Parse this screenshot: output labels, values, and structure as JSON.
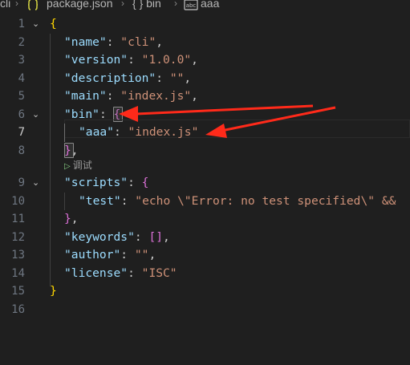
{
  "breadcrumb": {
    "items": [
      "cli",
      "package.json",
      "{ } bin",
      "aaa"
    ],
    "separator": "›",
    "icons": [
      "json-file-icon",
      "braces-icon",
      "string-key-icon"
    ]
  },
  "editor": {
    "lines": [
      {
        "n": "1",
        "fold": "⌄"
      },
      {
        "n": "2",
        "fold": ""
      },
      {
        "n": "3",
        "fold": ""
      },
      {
        "n": "4",
        "fold": ""
      },
      {
        "n": "5",
        "fold": ""
      },
      {
        "n": "6",
        "fold": "⌄"
      },
      {
        "n": "7",
        "fold": "",
        "active": true
      },
      {
        "n": "8",
        "fold": ""
      },
      {
        "n": "9",
        "fold": "⌄"
      },
      {
        "n": "10",
        "fold": ""
      },
      {
        "n": "11",
        "fold": ""
      },
      {
        "n": "12",
        "fold": ""
      },
      {
        "n": "13",
        "fold": ""
      },
      {
        "n": "14",
        "fold": ""
      },
      {
        "n": "15",
        "fold": ""
      },
      {
        "n": "16",
        "fold": ""
      }
    ],
    "code": {
      "l1": {
        "brace": "{"
      },
      "l2": {
        "key": "\"name\"",
        "colon": ": ",
        "val": "\"cli\"",
        "comma": ","
      },
      "l3": {
        "key": "\"version\"",
        "colon": ": ",
        "val": "\"1.0.0\"",
        "comma": ","
      },
      "l4": {
        "key": "\"description\"",
        "colon": ": ",
        "val": "\"\"",
        "comma": ","
      },
      "l5": {
        "key": "\"main\"",
        "colon": ": ",
        "val": "\"index.js\"",
        "comma": ","
      },
      "l6": {
        "key": "\"bin\"",
        "colon": ": ",
        "brace": "{"
      },
      "l7": {
        "key": "\"aaa\"",
        "colon": ": ",
        "val": "\"index.js\""
      },
      "l8": {
        "brace": "}",
        "comma": ","
      },
      "l9": {
        "key": "\"scripts\"",
        "colon": ": ",
        "brace": "{"
      },
      "l10": {
        "key": "\"test\"",
        "colon": ": ",
        "val": "\"echo \\\"Error: no test specified\\\" &&"
      },
      "l11": {
        "brace": "}",
        "comma": ","
      },
      "l12": {
        "key": "\"keywords\"",
        "colon": ": ",
        "brackets": "[]",
        "comma": ","
      },
      "l13": {
        "key": "\"author\"",
        "colon": ": ",
        "val": "\"\"",
        "comma": ","
      },
      "l14": {
        "key": "\"license\"",
        "colon": ": ",
        "val": "\"ISC\""
      },
      "l15": {
        "brace": "}"
      }
    },
    "codelens": {
      "label": "调试"
    }
  },
  "colors": {
    "background": "#1f1f1f",
    "key": "#9cdcfe",
    "string": "#ce9178",
    "brace_level1": "#ffd700",
    "brace_level2": "#da70d6",
    "annotation_arrow": "#ff2a1a"
  }
}
